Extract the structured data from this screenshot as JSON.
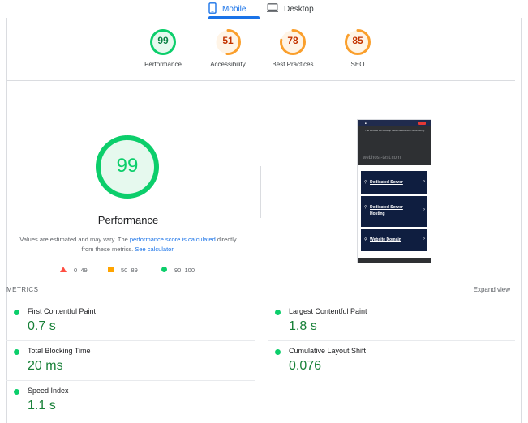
{
  "tabs": {
    "mobile": "Mobile",
    "desktop": "Desktop"
  },
  "category_scores": [
    {
      "label": "Performance",
      "score": "99",
      "value": 99,
      "color": "#0cce6b",
      "bg": "#e6f9ee"
    },
    {
      "label": "Accessibility",
      "score": "51",
      "value": 51,
      "color": "#fa9f2c",
      "bg": "#fff4e6"
    },
    {
      "label": "Best Practices",
      "score": "78",
      "value": 78,
      "color": "#fa9f2c",
      "bg": "#fff4e6"
    },
    {
      "label": "SEO",
      "score": "85",
      "value": 85,
      "color": "#fa9f2c",
      "bg": "#fff4e6"
    }
  ],
  "performance": {
    "score": "99",
    "value": 99,
    "title": "Performance",
    "desc_prefix": "Values are estimated and may vary. The ",
    "desc_link1": "performance score is calculated",
    "desc_mid": " directly from these metrics. ",
    "desc_link2": "See calculator."
  },
  "legend": {
    "fail": "0–49",
    "average": "50–89",
    "pass": "90–100",
    "colors": {
      "fail": "#ff4e42",
      "average": "#ffa400",
      "pass": "#0cce6b"
    }
  },
  "screenshot": {
    "hero_text": "The website we develop uses cookies with Webhosting.",
    "domain": "webhost-test.com",
    "cards": [
      "Dedicated Server",
      "Dedicated Server Hosting",
      "Website Domain"
    ]
  },
  "metrics": {
    "section_label": "METRICS",
    "expand_label": "Expand view",
    "items": [
      {
        "name": "First Contentful Paint",
        "value": "0.7 s"
      },
      {
        "name": "Largest Contentful Paint",
        "value": "1.8 s"
      },
      {
        "name": "Total Blocking Time",
        "value": "20 ms"
      },
      {
        "name": "Cumulative Layout Shift",
        "value": "0.076"
      },
      {
        "name": "Speed Index",
        "value": "1.1 s"
      }
    ]
  }
}
